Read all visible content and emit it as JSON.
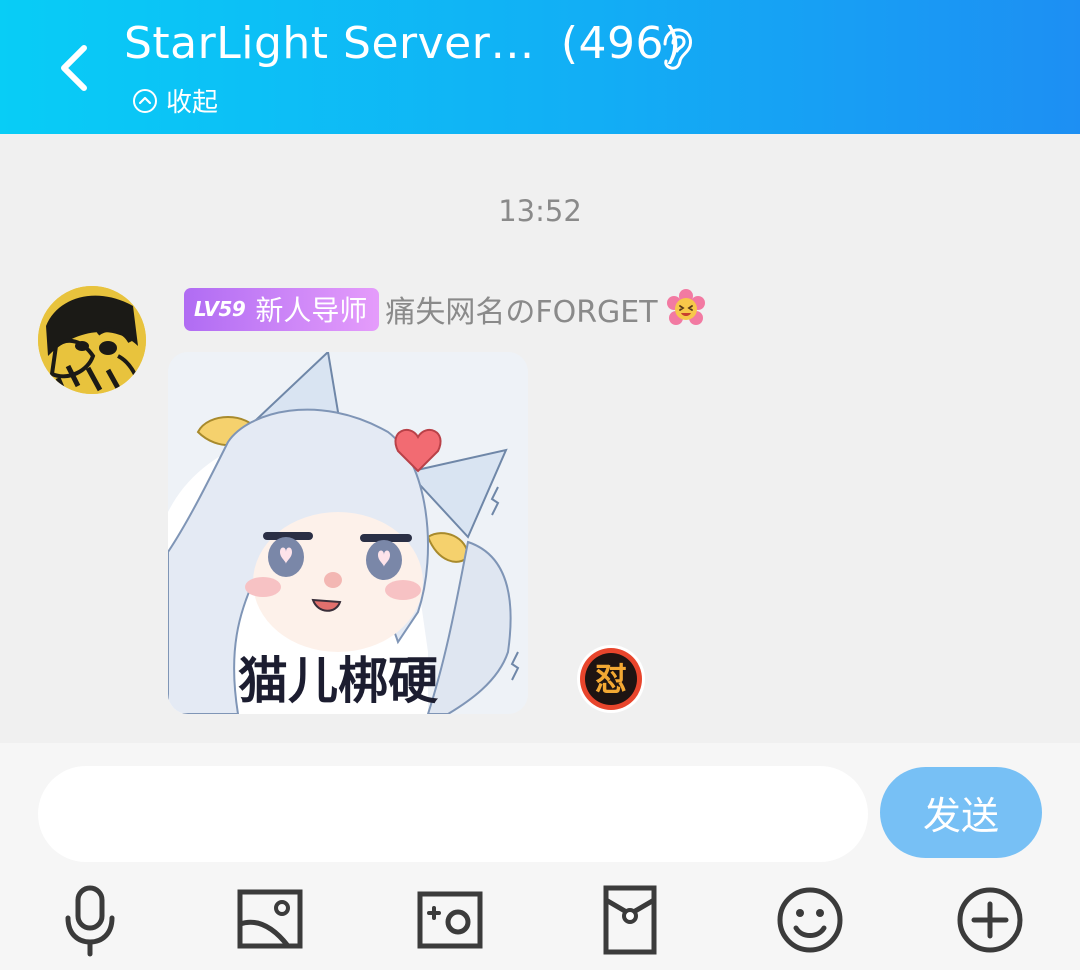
{
  "header": {
    "title": "StarLight Server…",
    "member_count": "(496)",
    "collapse_label": "收起",
    "back_icon": "chevron-left-icon",
    "ear_icon": "ear-icon"
  },
  "chat": {
    "timestamp": "13:52",
    "message": {
      "level_badge": "LV59",
      "role_badge": "新人导师",
      "sender_name": "痛失网名のFORGET",
      "sticker_caption": "猫儿梆硬"
    }
  },
  "composer": {
    "input_value": "",
    "send_label": "发送",
    "tools": [
      "microphone-icon",
      "image-icon",
      "camera-icon",
      "red-packet-icon",
      "emoji-icon",
      "plus-icon"
    ]
  },
  "colors": {
    "header_start": "#08cdf6",
    "header_end": "#1d8ff3",
    "badge_start": "#b06cf3",
    "badge_end": "#e59cfb",
    "send_button": "#77c0f5"
  }
}
